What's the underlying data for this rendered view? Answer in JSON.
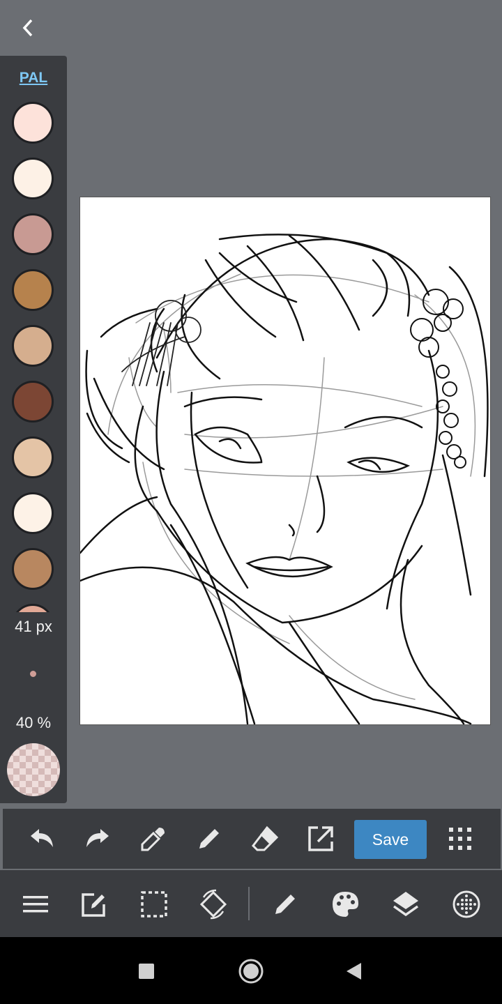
{
  "sidebar": {
    "palette_label": "PAL",
    "swatches": [
      "#fde2da",
      "#fdf1e6",
      "#c89a93",
      "#b6824d",
      "#d5ae8e",
      "#7c4634",
      "#e4c4a6",
      "#fdf2e7",
      "#b88760",
      "#e2a996"
    ],
    "brush_size": "41 px",
    "opacity": "40 %",
    "brush_color": "#cf9e97"
  },
  "toolbar": {
    "save_label": "Save",
    "icons": [
      "undo-icon",
      "redo-icon",
      "eyedropper-icon",
      "pencil-icon",
      "eraser-icon",
      "export-icon",
      "grid-dots-icon"
    ]
  },
  "bottom_toolbar": {
    "icons": [
      "menu-icon",
      "edit-icon",
      "select-icon",
      "rotate-icon",
      "brush-icon",
      "palette-icon",
      "layers-icon",
      "dotted-circle-icon"
    ]
  },
  "colors": {
    "accent": "#3d87c2",
    "background": "#6b6e73",
    "panel": "#3a3c40"
  }
}
